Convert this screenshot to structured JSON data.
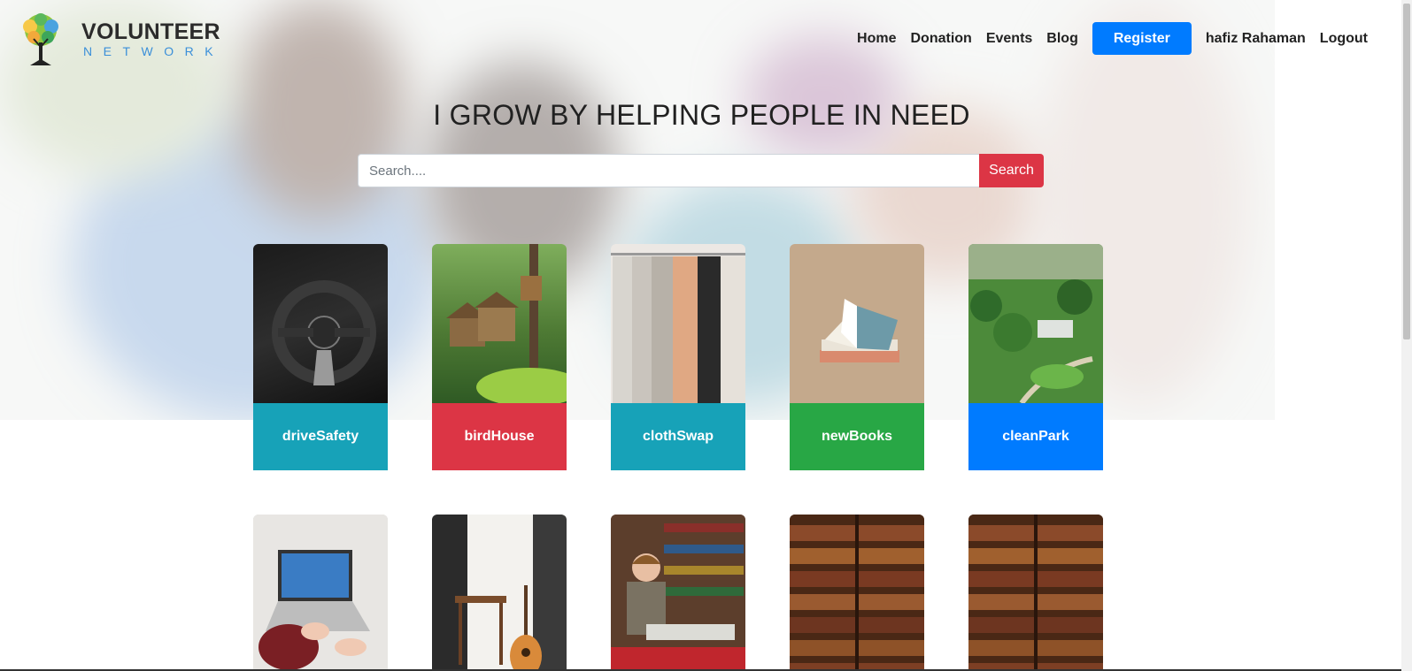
{
  "brand": {
    "name_line1": "VOLUNTEER",
    "name_line2": "NETWORK"
  },
  "nav": {
    "items": [
      "Home",
      "Donation",
      "Events",
      "Blog"
    ],
    "register_label": "Register",
    "user_name": "hafiz Rahaman",
    "logout_label": "Logout"
  },
  "hero": {
    "headline": "I GROW BY HELPING PEOPLE IN NEED"
  },
  "search": {
    "placeholder": "Search....",
    "button_label": "Search"
  },
  "cards": [
    {
      "label": "driveSafety",
      "color": "#17a2b8",
      "image": "car-steering-wheel"
    },
    {
      "label": "birdHouse",
      "color": "#dc3545",
      "image": "birdhouses-in-forest"
    },
    {
      "label": "clothSwap",
      "color": "#17a2b8",
      "image": "clothes-on-rack"
    },
    {
      "label": "newBooks",
      "color": "#28a745",
      "image": "open-book-stack"
    },
    {
      "label": "cleanPark",
      "color": "#007bff",
      "image": "aerial-park"
    }
  ],
  "cards_row2": [
    {
      "image": "laptop-typing"
    },
    {
      "image": "room-with-guitar"
    },
    {
      "image": "boy-reading-library"
    },
    {
      "image": "library-bookshelves"
    },
    {
      "image": "library-bookshelves"
    }
  ],
  "colors": {
    "primary": "#007bff",
    "danger": "#dc3545",
    "info": "#17a2b8",
    "success": "#28a745"
  }
}
